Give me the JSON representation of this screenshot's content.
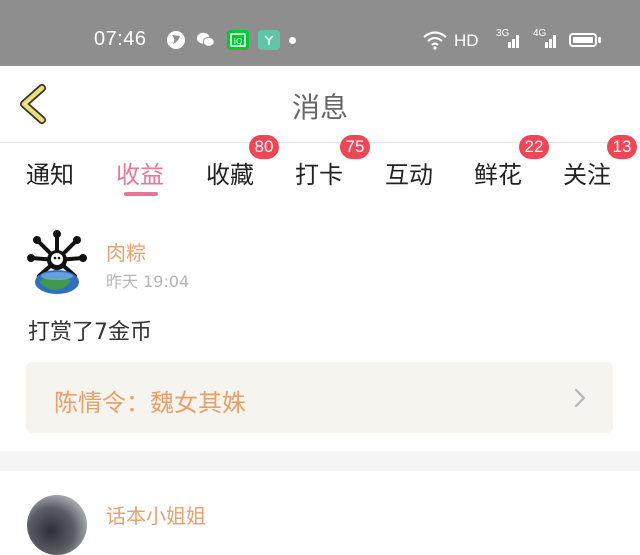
{
  "status_bar": {
    "time": "07:46",
    "app_icons": [
      "browser-icon",
      "wechat-icon",
      "iqiyi-icon",
      "app-icon"
    ],
    "hd": "HD",
    "network_1": "3G",
    "network_2": "4G"
  },
  "header": {
    "title": "消息"
  },
  "tabs": [
    {
      "label": "通知",
      "active": false,
      "badge": ""
    },
    {
      "label": "收益",
      "active": true,
      "badge": ""
    },
    {
      "label": "收藏",
      "active": false,
      "badge": "80"
    },
    {
      "label": "打卡",
      "active": false,
      "badge": "75"
    },
    {
      "label": "互动",
      "active": false,
      "badge": ""
    },
    {
      "label": "鲜花",
      "active": false,
      "badge": "22"
    },
    {
      "label": "关注",
      "active": false,
      "badge": "13"
    }
  ],
  "messages": [
    {
      "nickname": "肉粽",
      "time": "昨天 19:04",
      "text": "打赏了7金币",
      "link": "陈情令：魏女其姝"
    },
    {
      "nickname": "话本小姐姐"
    }
  ],
  "colors": {
    "accent": "#e8769a",
    "nickname": "#e9a06d",
    "badge": "#ef4555",
    "status_bar": "#8e8e8e"
  }
}
